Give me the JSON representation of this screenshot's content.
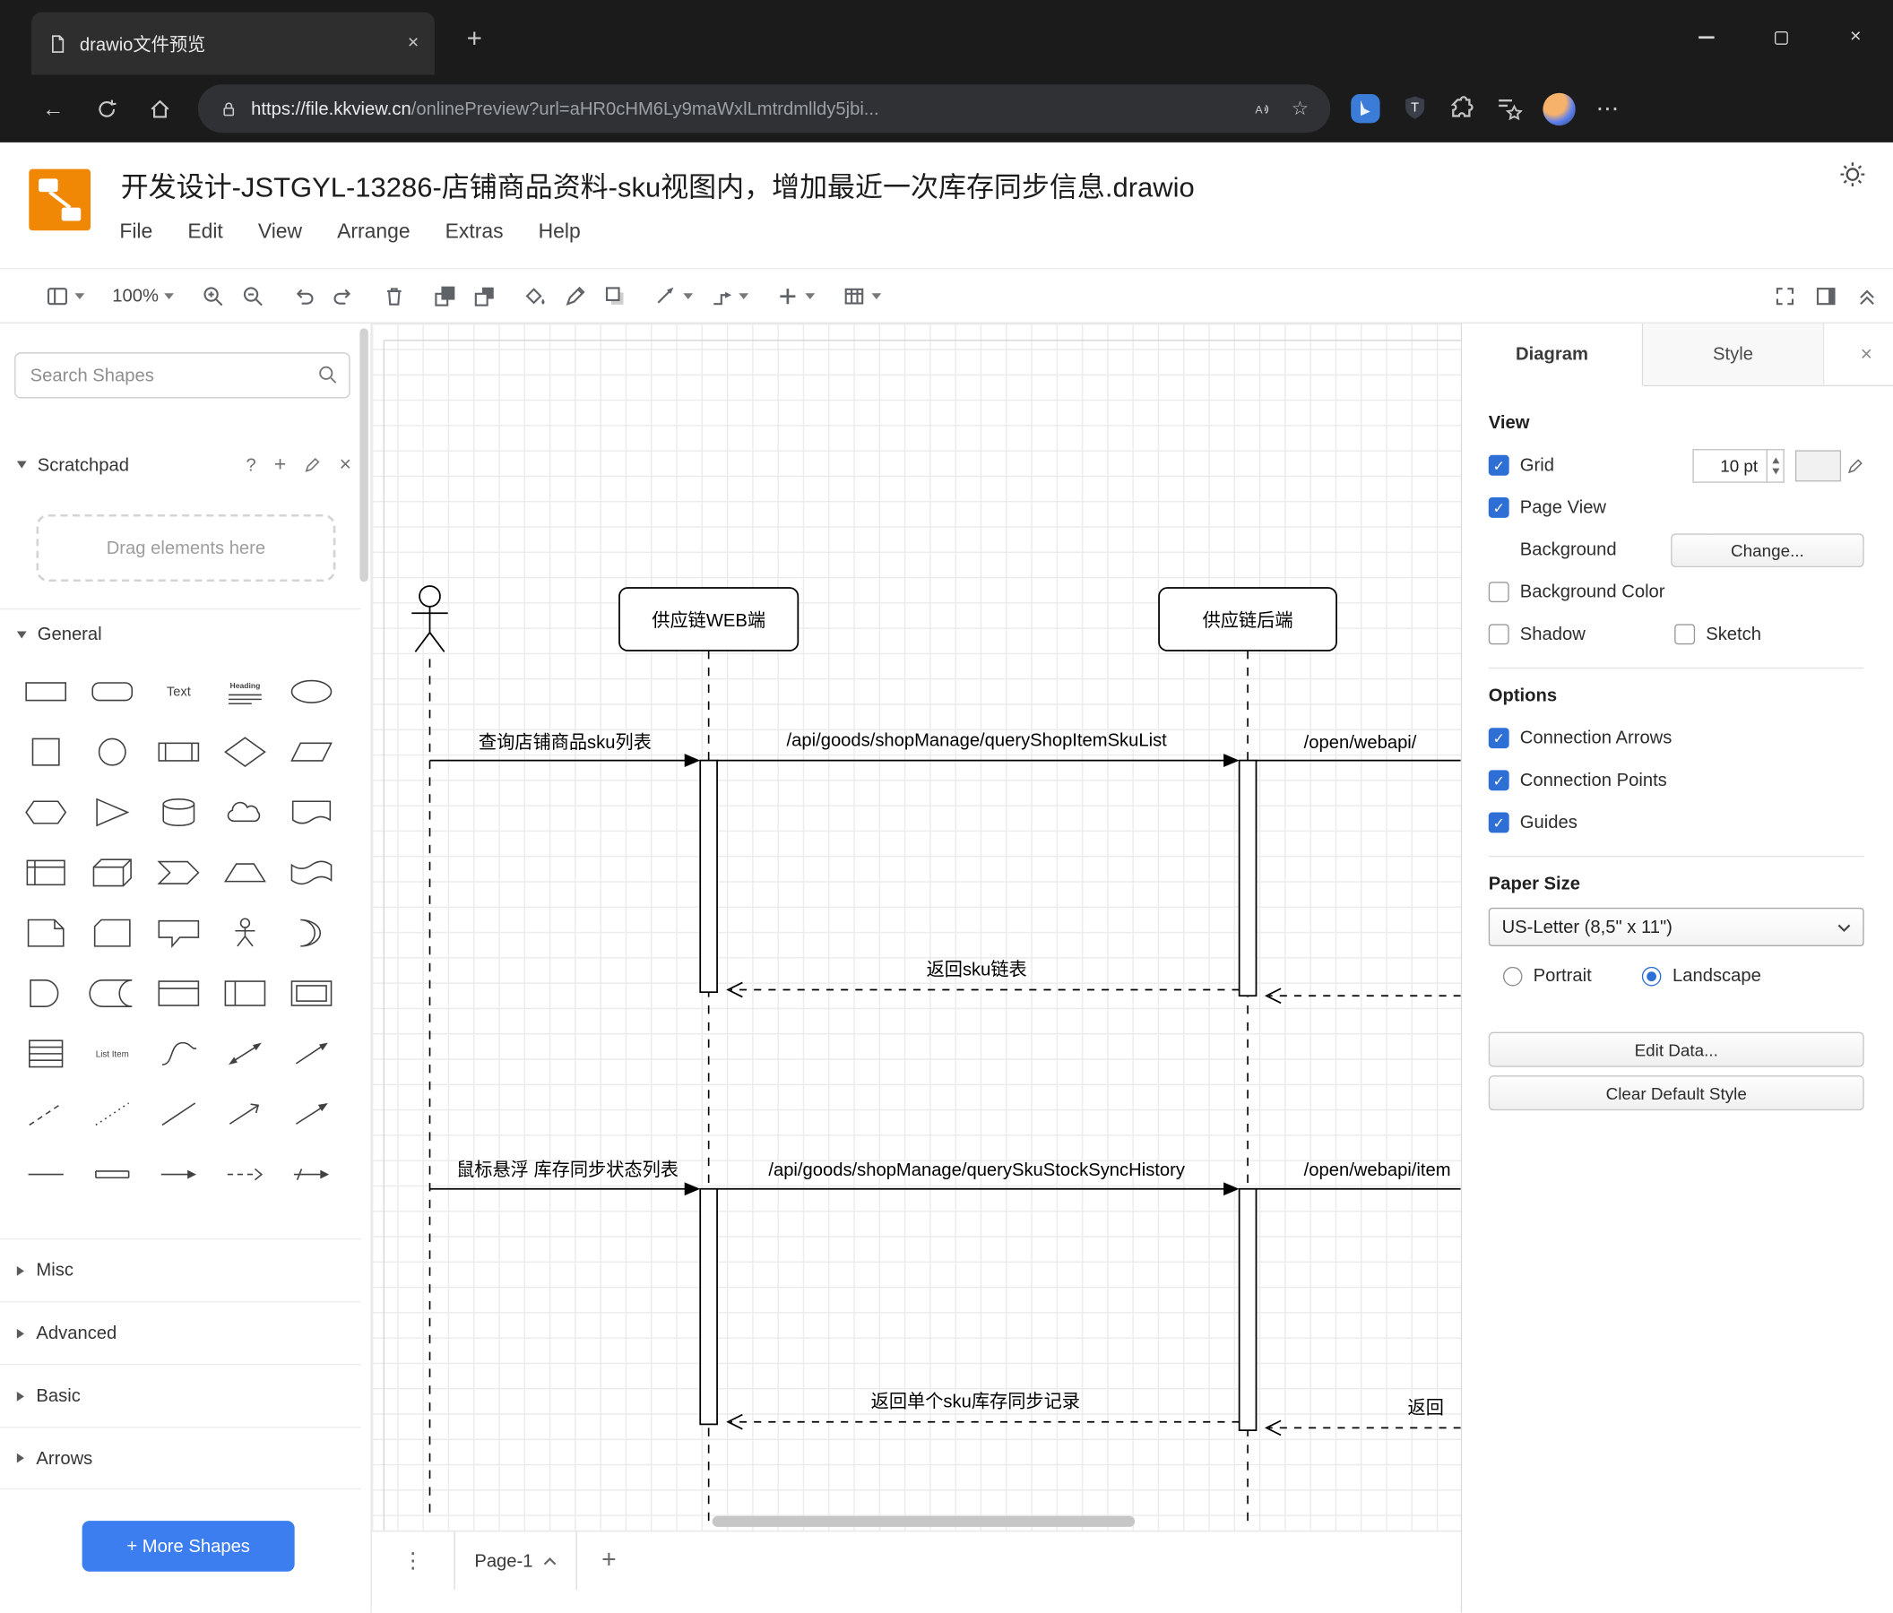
{
  "colors": {
    "accent_blue": "#2e6fd6",
    "logo_orange": "#f08705",
    "more_shapes_blue": "#3c7df0",
    "chrome_dark": "#1b1b1b"
  },
  "icons": {
    "help": "?",
    "plus": "+",
    "close": "×",
    "back_arrow": "←",
    "star": "☆",
    "dots_h": "⋯",
    "dots_v": "⋮"
  },
  "browser": {
    "tab_title": "drawio文件预览",
    "url_host": "https://file.kkview.cn",
    "url_rest": "/onlinePreview?url=aHR0cHM6Ly9maWxlLmtrdmlldy5jbi..."
  },
  "app": {
    "title": "开发设计-JSTGYL-13286-店铺商品资料-sku视图内，增加最近一次库存同步信息.drawio",
    "menu": [
      "File",
      "Edit",
      "View",
      "Arrange",
      "Extras",
      "Help"
    ],
    "zoom": "100%"
  },
  "sidebar": {
    "search_placeholder": "Search Shapes",
    "scratchpad_title": "Scratchpad",
    "scratchpad_hint": "Drag elements here",
    "sections": {
      "general": "General",
      "misc": "Misc",
      "advanced": "Advanced",
      "basic": "Basic",
      "arrows": "Arrows"
    },
    "shape_labels": {
      "text": "Text",
      "heading": "Heading",
      "list_item": "List Item"
    },
    "general_shapes": [
      "rectangle",
      "rounded-rectangle",
      "text",
      "heading",
      "ellipse",
      "square",
      "circle",
      "process",
      "diamond",
      "parallelogram",
      "hexagon",
      "triangle",
      "cylinder",
      "cloud",
      "document",
      "internal-storage",
      "cube",
      "step",
      "trapezoid",
      "tape",
      "note",
      "card",
      "callout",
      "actor",
      "or",
      "and",
      "data-storage",
      "container",
      "vertical-container",
      "horizontal-container",
      "list",
      "list-item",
      "curve",
      "bidirectional-arrow",
      "arrow",
      "dashed-line",
      "dotted-line",
      "line",
      "arrow-open",
      "arrow-filled",
      "bold-line",
      "link-edge",
      "arrow-edge",
      "dashed-arrow-edge",
      "connector-arrow"
    ],
    "more_shapes_label": "+ More Shapes"
  },
  "canvas": {
    "participants": [
      {
        "type": "actor"
      },
      {
        "label": "供应链WEB端"
      },
      {
        "label": "供应链后端"
      }
    ],
    "messages": [
      {
        "label": "查询店铺商品sku列表",
        "type": "sync"
      },
      {
        "label": "/api/goods/shopManage/queryShopItemSkuList",
        "type": "sync"
      },
      {
        "label": "/open/webapi/",
        "type": "sync",
        "truncated": true
      },
      {
        "label": "返回sku链表",
        "type": "return"
      },
      {
        "label": "鼠标悬浮 库存同步状态列表",
        "type": "sync"
      },
      {
        "label": "/api/goods/shopManage/querySkuStockSyncHistory",
        "type": "sync"
      },
      {
        "label": "/open/webapi/item",
        "type": "sync",
        "truncated": true
      },
      {
        "label": "返回单个sku库存同步记录",
        "type": "return"
      },
      {
        "label": "返回",
        "type": "return",
        "truncated": true
      }
    ]
  },
  "footer": {
    "page_tab": "Page-1"
  },
  "format_panel": {
    "tabs": {
      "diagram": "Diagram",
      "style": "Style"
    },
    "view": {
      "heading": "View",
      "grid": {
        "label": "Grid",
        "checked": true,
        "size": "10 pt"
      },
      "page_view": {
        "label": "Page View",
        "checked": true
      },
      "background": {
        "label": "Background",
        "button": "Change..."
      },
      "background_color": {
        "label": "Background Color",
        "checked": false
      },
      "shadow": {
        "label": "Shadow",
        "checked": false
      },
      "sketch": {
        "label": "Sketch",
        "checked": false
      }
    },
    "options": {
      "heading": "Options",
      "connection_arrows": {
        "label": "Connection Arrows",
        "checked": true
      },
      "connection_points": {
        "label": "Connection Points",
        "checked": true
      },
      "gu ides_placeholder": null,
      "guides": {
        "label": "Guides",
        "checked": true
      }
    },
    "paper": {
      "heading": "Paper Size",
      "size": "US-Letter (8,5\" x 11\")",
      "portrait": "Portrait",
      "landscape": "Landscape",
      "orientation": "landscape"
    },
    "buttons": {
      "edit_data": "Edit Data...",
      "clear_default_style": "Clear Default Style"
    }
  }
}
